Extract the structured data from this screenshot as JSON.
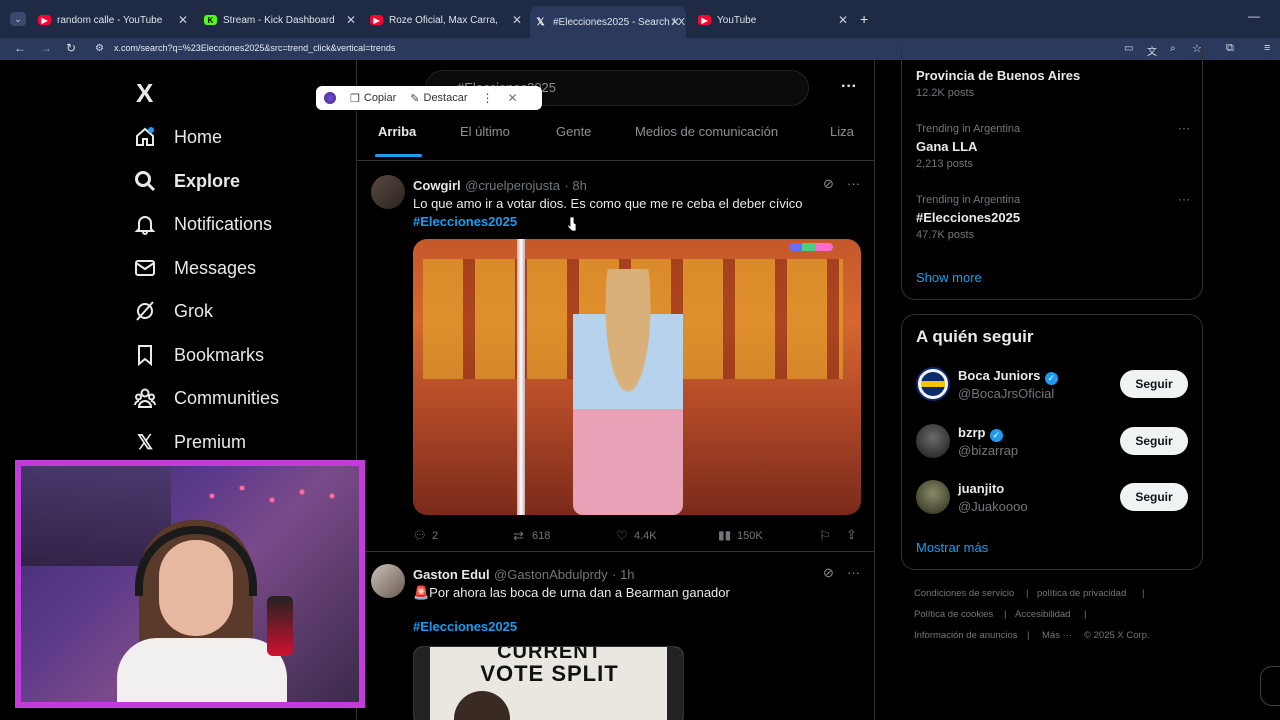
{
  "browser": {
    "tabs": [
      {
        "title": "random calle - YouTube",
        "favicon": "youtube-icon"
      },
      {
        "title": "Stream - Kick Dashboard",
        "favicon": "kick-icon"
      },
      {
        "title": "Roze Oficial, Max Carra, Valen, Ma",
        "favicon": "youtube-icon"
      },
      {
        "title": "#Elecciones2025 - Search / X",
        "favicon": "x-icon"
      },
      {
        "title": "YouTube",
        "favicon": "youtube-icon"
      }
    ],
    "url": "x.com/search?q=%23Elecciones2025&src=trend_click&vertical=trends"
  },
  "sidebar": {
    "logo": "X",
    "items": [
      {
        "label": "Home",
        "icon": "home-icon"
      },
      {
        "label": "Explore",
        "icon": "search-icon"
      },
      {
        "label": "Notifications",
        "icon": "bell-icon"
      },
      {
        "label": "Messages",
        "icon": "mail-icon"
      },
      {
        "label": "Grok",
        "icon": "grok-icon"
      },
      {
        "label": "Bookmarks",
        "icon": "bookmark-icon"
      },
      {
        "label": "Communities",
        "icon": "communities-icon"
      },
      {
        "label": "Premium",
        "icon": "x-icon"
      }
    ]
  },
  "search": {
    "query": "#Elecciones2025",
    "tabs": [
      "Arriba",
      "El último",
      "Gente",
      "Medios de comunicación",
      "Liza"
    ]
  },
  "popup": {
    "copy": "Copiar",
    "highlight": "Destacar"
  },
  "tweets": [
    {
      "name": "Cowgirl",
      "handle": "@cruelperojusta",
      "time": "· 8h",
      "text": "Lo que amo ir a votar dios. Es como que me re ceba el deber cívico",
      "hashtag": "#Elecciones2025",
      "replies": "2",
      "retweets": "618",
      "likes": "4.4K",
      "views": "150K"
    },
    {
      "name": "Gaston Edul",
      "handle": "@GastonAbdulprdy",
      "time": "· 1h",
      "text": "🚨Por ahora las boca de urna dan a Bearman ganador",
      "hashtag": "#Elecciones2025",
      "image_text_1": "CURRENT",
      "image_text_2": "VOTE SPLIT"
    }
  ],
  "trends": {
    "top": {
      "name": "Provincia de Buenos Aires",
      "count": "12.2K posts"
    },
    "items": [
      {
        "context": "Trending in Argentina",
        "name": "Gana LLA",
        "count": "2,213 posts"
      },
      {
        "context": "Trending in Argentina",
        "name": "#Elecciones2025",
        "count": "47.7K posts"
      }
    ],
    "show_more": "Show more"
  },
  "who_to_follow": {
    "title": "A quién seguir",
    "users": [
      {
        "name": "Boca Juniors",
        "handle": "@BocaJrsOficial",
        "verified": true,
        "button": "Seguir"
      },
      {
        "name": "bzrp",
        "handle": "@bizarrap",
        "verified": true,
        "button": "Seguir"
      },
      {
        "name": "juanjito",
        "handle": "@Juakoooo",
        "verified": false,
        "button": "Seguir"
      }
    ],
    "show_more": "Mostrar más"
  },
  "footer": {
    "links": [
      "Condiciones de servicio",
      "política de privacidad",
      "Política de cookies",
      "Accesibilidad",
      "Información de anuncios",
      "Más ···",
      "© 2025 X Corp."
    ],
    "separator": "|"
  },
  "colors": {
    "accent": "#1d9bf0",
    "background": "#000000",
    "webcam_border": "#c43bdc",
    "tab_bar": "#1f2a44"
  }
}
